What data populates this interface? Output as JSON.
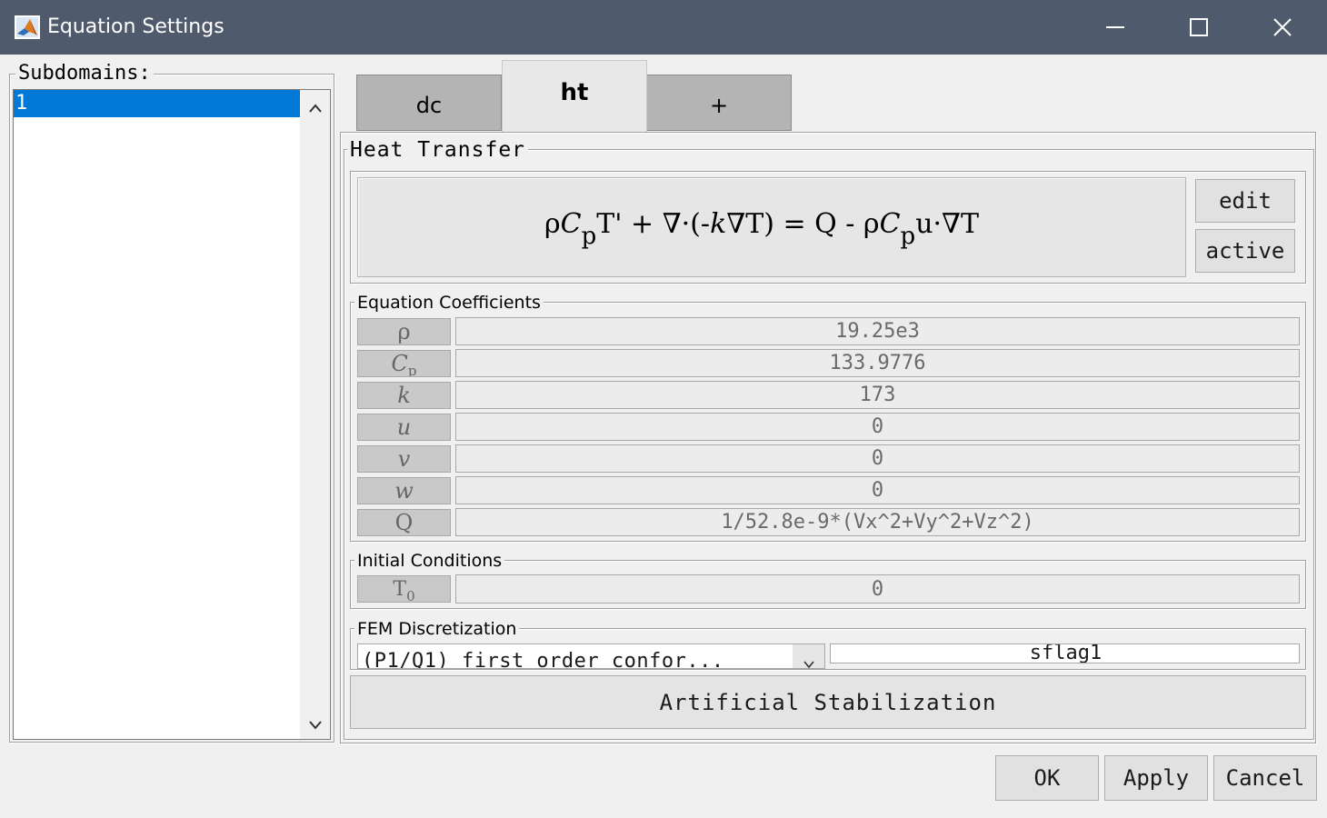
{
  "window": {
    "title": "Equation Settings"
  },
  "subdomains": {
    "label": "Subdomains:",
    "items": [
      "1"
    ]
  },
  "tabs": [
    {
      "label": "dc"
    },
    {
      "label": "ht"
    },
    {
      "label": "+"
    }
  ],
  "heat_transfer": {
    "title": "Heat Transfer",
    "edit_label": "edit",
    "active_label": "active"
  },
  "coefficients": {
    "title": "Equation Coefficients",
    "rows": [
      {
        "symbol": "ρ",
        "value": "19.25e3"
      },
      {
        "symbol": "C",
        "subscript": "p",
        "value": "133.9776"
      },
      {
        "symbol": "k",
        "value": "173"
      },
      {
        "symbol": "u",
        "value": "0"
      },
      {
        "symbol": "v",
        "value": "0"
      },
      {
        "symbol": "w",
        "value": "0"
      },
      {
        "symbol": "Q",
        "value": "1/52.8e-9*(Vx^2+Vy^2+Vz^2)"
      }
    ]
  },
  "initial_conditions": {
    "title": "Initial Conditions",
    "symbol": "T",
    "subscript": "0",
    "value": "0"
  },
  "fem": {
    "title": "FEM Discretization",
    "element_value": "(P1/Q1) first order confor...",
    "shape_value": "sflag1",
    "stabilization_label": "Artificial Stabilization"
  },
  "buttons": {
    "ok": "OK",
    "apply": "Apply",
    "cancel": "Cancel"
  }
}
